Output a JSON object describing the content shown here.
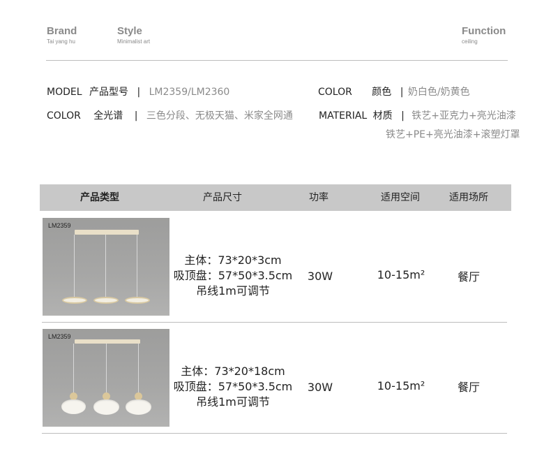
{
  "header": {
    "brand": {
      "title": "Brand",
      "sub": "Tai yang hu"
    },
    "style": {
      "title": "Style",
      "sub": "Minimalist art"
    },
    "function": {
      "title": "Function",
      "sub": "ceiling"
    }
  },
  "specs": {
    "model_label": "MODEL",
    "model_cn": "产品型号",
    "model_value": "LM2359/LM2360",
    "color_label": "COLOR",
    "color_cn": "颜色",
    "color_value": "奶白色/奶黄色",
    "color2_label": "COLOR",
    "color2_cn": "全光谱",
    "color2_value": "三色分段、无极天猫、米家全网通",
    "material_label": "MATERIAL",
    "material_cn": "材质",
    "material_value1": "铁艺+亚克力+亮光油漆",
    "material_value2": "铁艺+PE+亮光油漆+滚塑灯罩",
    "sep": "|"
  },
  "table": {
    "headers": [
      "产品类型",
      "产品尺寸",
      "功率",
      "适用空间",
      "适用场所"
    ],
    "rows": [
      {
        "model": "LM2359",
        "size": [
          "主体：73*20*3cm",
          "吸顶盘：57*50*3.5cm",
          "吊线1m可调节"
        ],
        "power": "30W",
        "space": "10-15m²",
        "place": "餐厅"
      },
      {
        "model": "LM2359",
        "size": [
          "主体：73*20*18cm",
          "吸顶盘：57*50*3.5cm",
          "吊线1m可调节"
        ],
        "power": "30W",
        "space": "10-15m²",
        "place": "餐厅"
      }
    ]
  }
}
